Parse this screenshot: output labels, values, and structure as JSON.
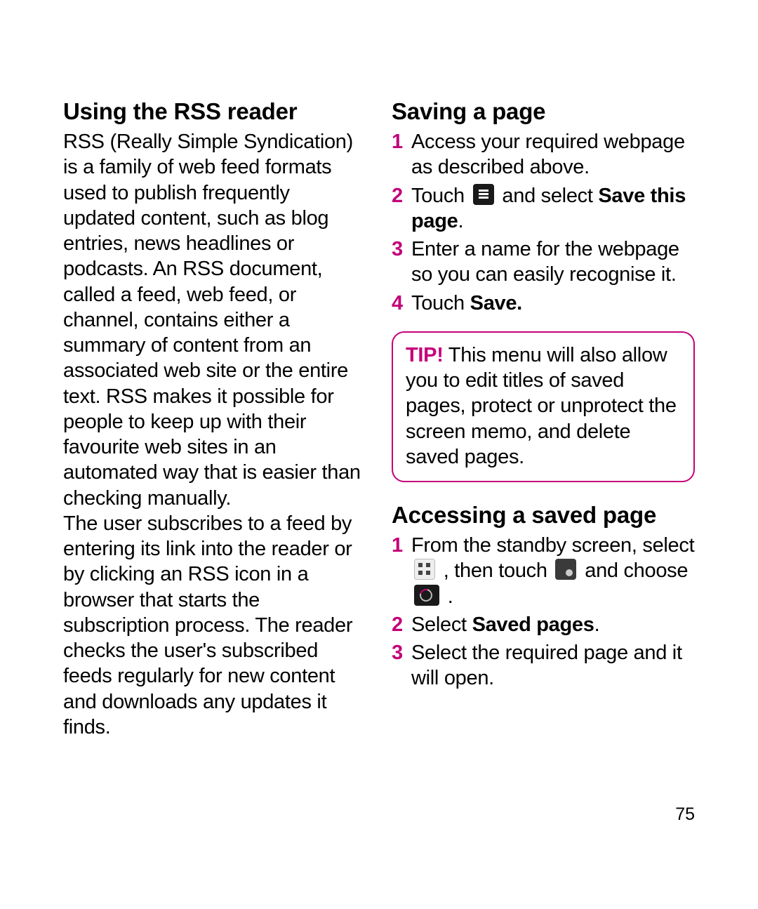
{
  "page_number": "75",
  "left": {
    "heading": "Using the RSS reader",
    "para1": "RSS (Really Simple Syndication) is a family of web feed formats used to publish frequently updated content, such as blog entries, news headlines or podcasts. An RSS document, called a feed, web feed, or channel, contains either a summary of content from an associated web site or the entire text. RSS makes it possible for people to keep up with their favourite web sites in an automated way that is easier than checking manually.",
    "para2": "The user subscribes to a feed by entering its link into the reader or by clicking an RSS icon in a browser that starts the subscription process. The reader checks the user's subscribed feeds regularly for new content and downloads any updates it finds."
  },
  "right": {
    "saving": {
      "heading": "Saving a page",
      "steps": {
        "s1": "Access your required webpage as described above.",
        "s2_pre": "Touch ",
        "s2_post_1": " and select ",
        "s2_bold": "Save this page",
        "s2_end": ".",
        "s3": "Enter a name for the webpage so you can easily recognise it.",
        "s4_pre": "Touch ",
        "s4_bold": "Save."
      },
      "tip_label": "TIP!",
      "tip_body": " This menu will also allow you to edit titles of saved pages, protect or unprotect the screen memo, and delete saved pages."
    },
    "accessing": {
      "heading": "Accessing a saved page",
      "steps": {
        "s1_a": "From the standby screen, select ",
        "s1_b": " , then touch ",
        "s1_c": " and choose ",
        "s1_d": " .",
        "s2_pre": "Select ",
        "s2_bold": "Saved pages",
        "s2_end": ".",
        "s3": "Select the required page and it will open."
      }
    }
  },
  "numbers": {
    "n1": "1",
    "n2": "2",
    "n3": "3",
    "n4": "4"
  }
}
